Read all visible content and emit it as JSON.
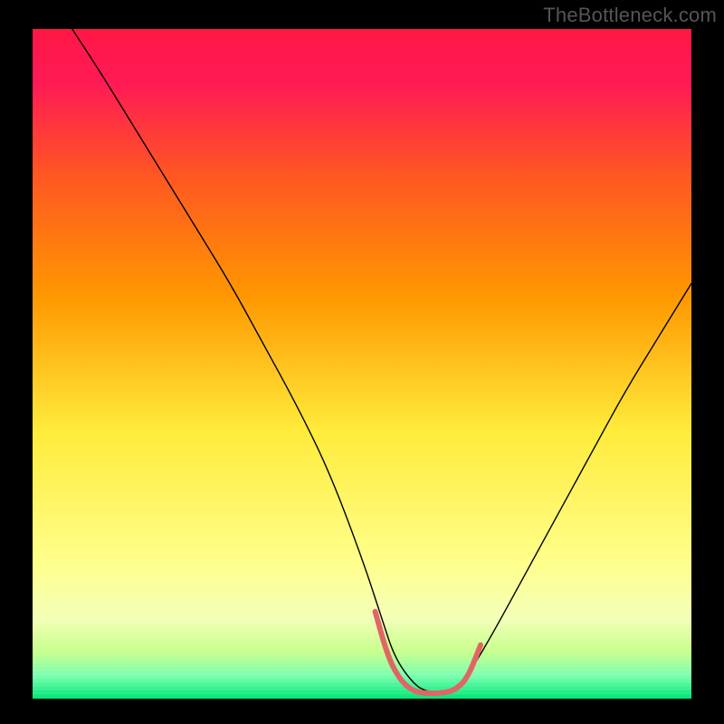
{
  "attribution": "TheBottleneck.com",
  "chart_data": {
    "type": "line",
    "title": "",
    "xlabel": "",
    "ylabel": "",
    "xlim": [
      0,
      100
    ],
    "ylim": [
      0,
      100
    ],
    "grid": false,
    "background_gradient": {
      "top": "#ff1744",
      "upper_mid": "#ff9800",
      "mid": "#ffeb3b",
      "lower": "#ffff8d",
      "bottom": "#00e676"
    },
    "black_border_bands": {
      "left_width_pct": 5,
      "right_width_pct": 5,
      "top_height_pct": 4,
      "bottom_height_pct": 4
    },
    "series": [
      {
        "name": "main-curve",
        "color": "#000000",
        "stroke_width": 1.4,
        "x": [
          6,
          10,
          15,
          20,
          25,
          30,
          35,
          40,
          45,
          50,
          53,
          55,
          58,
          60,
          63,
          65,
          67,
          70,
          75,
          80,
          85,
          90,
          95,
          100
        ],
        "values": [
          100,
          94,
          86,
          78,
          70,
          62,
          53,
          44,
          34,
          21,
          12,
          6,
          2,
          1,
          1,
          2,
          5,
          10,
          19,
          28,
          37,
          46,
          54,
          62
        ]
      },
      {
        "name": "highlight-segment",
        "color": "#e06666",
        "stroke_width": 6,
        "x": [
          52,
          54,
          56,
          58,
          60,
          62,
          64,
          66,
          68
        ],
        "values": [
          13,
          6,
          2.5,
          1,
          0.8,
          0.8,
          1.2,
          3,
          8
        ]
      }
    ]
  }
}
